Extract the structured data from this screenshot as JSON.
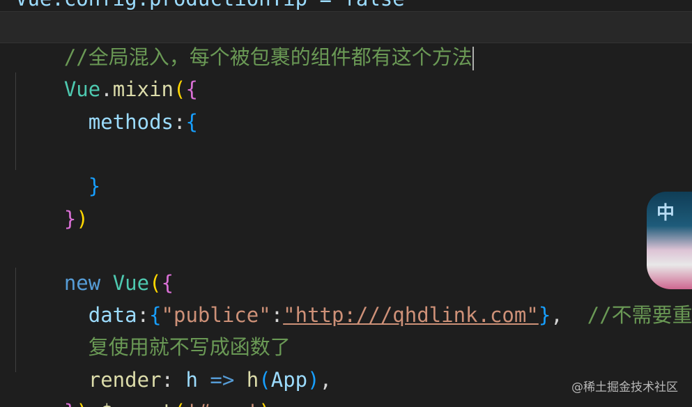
{
  "editor": {
    "top_cut_line": "Vue.config.productionTip = false",
    "lines": {
      "l1_comment": "//全局混入，每个被包裹的组件都有这个方法",
      "l2_vue": "Vue",
      "l2_dot": ".",
      "l2_mixin": "mixin",
      "l2_open_paren": "(",
      "l2_open_brace": "{",
      "l3_methods": "methods",
      "l3_colon": ":",
      "l3_open_brace": "{",
      "l5_close_brace": "}",
      "l6_close_brace": "}",
      "l6_close_paren": ")",
      "l8_new": "new",
      "l8_vue": "Vue",
      "l8_open_paren": "(",
      "l8_open_brace": "{",
      "l9_data": "data",
      "l9_colon": ":",
      "l9_open_brace": "{",
      "l9_key": "\"publice\"",
      "l9_kv_colon": ":",
      "l9_value": "\"http:///qhdlink.com\"",
      "l9_close_brace": "}",
      "l9_comma": ",",
      "l9_comment": "//不需要重",
      "l10_comment_cont": "复使用就不写成函数了",
      "l11_render": "render",
      "l11_colon": ":",
      "l11_h_param": "h",
      "l11_arrow": "=>",
      "l11_h_call": "h",
      "l11_open_paren": "(",
      "l11_app": "App",
      "l11_close_paren": ")",
      "l11_comma": ",",
      "l12_close_brace": "}",
      "l12_close_paren": ")",
      "l12_dot": ".",
      "l12_mount": "$mount",
      "l12_open_paren": "(",
      "l12_arg": "'#app'",
      "l12_end_paren": ")"
    }
  },
  "sticker_text": "中",
  "watermark": "@稀土掘金技术社区",
  "colors": {
    "background": "#1e1e1e",
    "comment": "#6a9955",
    "type": "#4ec9b0",
    "function": "#dcdcaa",
    "property": "#9cdcfe",
    "keyword": "#569cd6",
    "string": "#ce9178",
    "bracket_level1": "#da70d6",
    "bracket_level2": "#179fff",
    "bracket_level3": "#ffd700"
  }
}
